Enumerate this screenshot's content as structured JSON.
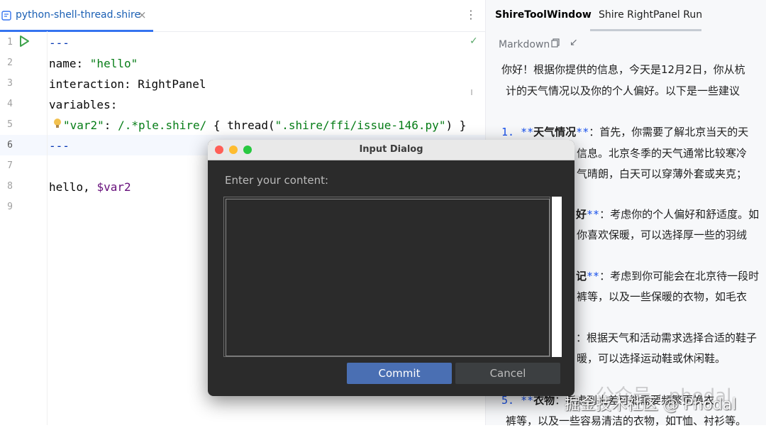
{
  "editor": {
    "tab": {
      "title": "python-shell-thread.shire",
      "close_glyph": "×"
    },
    "more_glyph": "⋮",
    "line_numbers": [
      "1",
      "2",
      "3",
      "4",
      "5",
      "6",
      "7",
      "8",
      "9"
    ],
    "lines": {
      "l1": "---",
      "l2_key": "name: ",
      "l2_val": "\"hello\"",
      "l3": "interaction: RightPanel",
      "l4": "variables:",
      "l5_key": "\"var2\"",
      "l5_colon": ": ",
      "l5_pattern": "/.*ple.shire/",
      "l5_brace_open": " { thread(",
      "l5_arg": "\".shire/ffi/issue-146.py\"",
      "l5_brace_close": ") }",
      "l6": "---",
      "l8_text": "hello, ",
      "l8_var": "$var2"
    },
    "check_glyph": "✓",
    "icons": {
      "run": "run-icon",
      "check": "check-icon",
      "bulb": "bulb-icon",
      "file": "shire-file-icon"
    }
  },
  "right_panel": {
    "tabs": [
      "ShireToolWindow",
      "Shire RightPanel Run"
    ],
    "markdown_label": "Markdown",
    "arrow_glyph": "↙",
    "content": {
      "intro1": "你好！根据你提供的信息，今天是12月2日，你从杭",
      "intro2": "计的天气情况以及你的个人偏好。以下是一些建议",
      "i1_num": "1. ",
      "i1_mk_open": "**",
      "i1_title": "天气情况",
      "i1_mk_close": "**",
      "i1_text": "：首先，你需要了解北京当天的天",
      "i1_l2": "信息。北京冬季的天气通常比较寒冷",
      "i1_l3": "气晴朗，白天可以穿薄外套或夹克；",
      "i2_title_tail": "好",
      "i2_mk": "**",
      "i2_text": "：考虑你的个人偏好和舒适度。如",
      "i2_l2": "你喜欢保暖，可以选择厚一些的羽绒",
      "i3_title_tail": "记",
      "i3_mk": "**",
      "i3_text": "：考虑到你可能会在北京待一段时",
      "i3_l2": "裤等，以及一些保暖的衣物，如毛衣",
      "i4_text": "：根据天气和活动需求选择合适的鞋子",
      "i4_l2": "暖，可以选择运动鞋或休闲鞋。",
      "i5_num": "5. ",
      "i5_mk_open": "**",
      "i5_title": "衣物",
      "i5_text": "：考虑到出差可能需要频繁更换衣",
      "i5_l2": "裤等，以及一些容易清洁的衣物，如T恤、衬衫等。"
    }
  },
  "dialog": {
    "title": "Input Dialog",
    "prompt": "Enter your content:",
    "input_value": "",
    "commit_label": "Commit",
    "cancel_label": "Cancel"
  },
  "watermark": {
    "text": "掘金技术社区 @ Phodal",
    "faint_text": "公众号 · phodal"
  },
  "colors": {
    "tab_accent": "#3574f0",
    "string_green": "#067d17",
    "keyword_blue": "#0033b3",
    "commit_blue": "#4a6fb3",
    "dialog_bg": "#2b2b2b"
  }
}
